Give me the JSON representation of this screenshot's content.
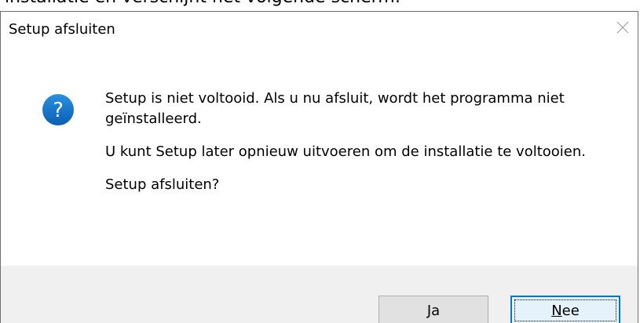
{
  "background_text": "installatie en verschijnt het volgende scherm:",
  "dialog": {
    "title": "Setup afsluiten",
    "close_icon": "close-icon",
    "question_icon": "question-icon",
    "accent_color": "#0078d7",
    "message": {
      "line1": "Setup is niet voltooid. Als u nu afsluit, wordt het programma niet geïnstalleerd.",
      "line2": "U kunt Setup later opnieuw uitvoeren om de installatie te voltooien.",
      "line3": "Setup afsluiten?"
    },
    "buttons": {
      "yes": {
        "accel": "J",
        "rest": "a"
      },
      "no": {
        "accel": "N",
        "rest": "ee"
      }
    }
  }
}
